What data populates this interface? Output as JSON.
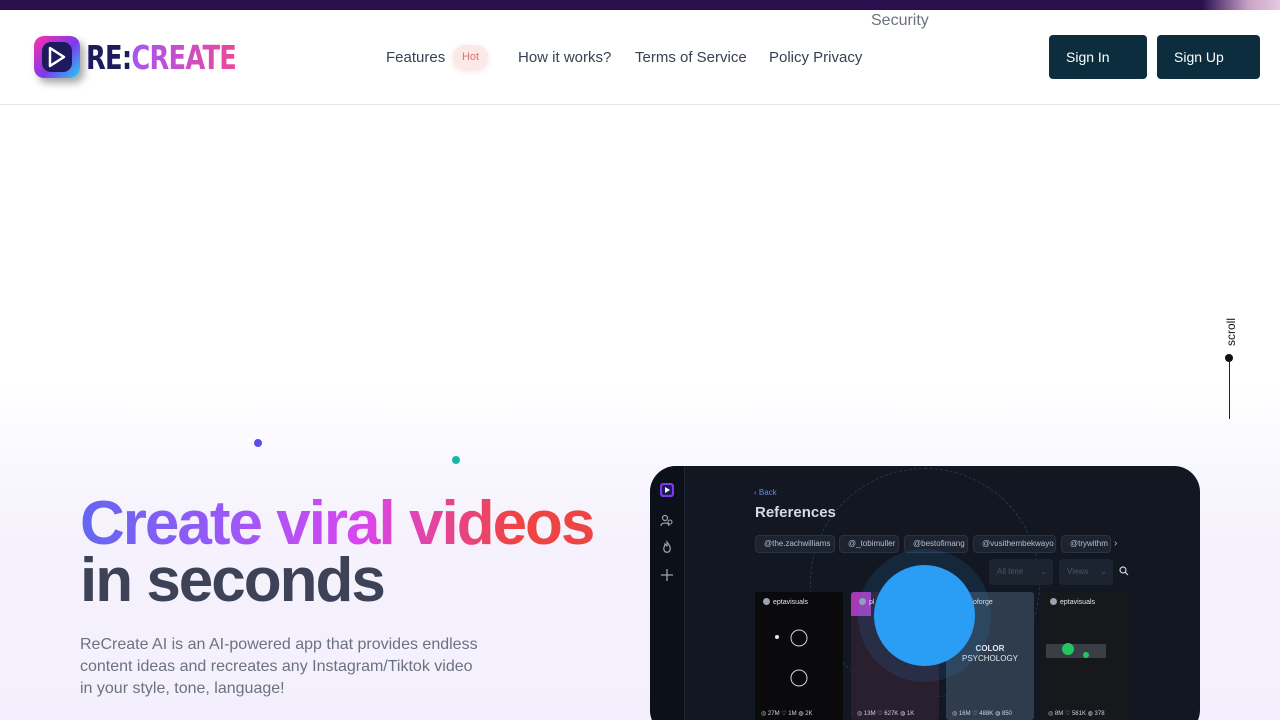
{
  "topbar": {
    "security_label": "Security"
  },
  "logo": {
    "prefix": "RE:",
    "suffix": "CREATE"
  },
  "nav": {
    "features": "Features",
    "hot_badge": "Hot",
    "how_it_works": "How it works?",
    "terms": "Terms of Service",
    "privacy": "Policy Privacy"
  },
  "auth": {
    "sign_in": "Sign In",
    "sign_up": "Sign Up"
  },
  "scroll": {
    "label": "scroll"
  },
  "hero": {
    "headline_gradient": "Create viral videos",
    "headline_plain": "in seconds",
    "description": "ReCreate AI is an AI-powered app that provides endless content ideas and recreates any Instagram/Tiktok video in your style, tone, language!"
  },
  "app_preview": {
    "back": "‹ Back",
    "title": "References",
    "chips": [
      "@the.zachwilliams",
      "@_tobimuller",
      "@bestofimang",
      "@vusithembekwayo",
      "@trywithm"
    ],
    "filters": [
      "All time",
      "Views"
    ],
    "cards": [
      {
        "user": "eptavisuals",
        "stats": "◎ 27M  ♡ 1M  ◍ 2K"
      },
      {
        "user": "pl",
        "stats": "◎ 13M  ♡ 627K  ◍ 1K"
      },
      {
        "user": "coloforge",
        "title": "COLOR",
        "subtitle": "PSYCHOLOGY",
        "stats": "◎ 16M  ♡ 488K  ◍ 850"
      },
      {
        "user": "eptavisuals",
        "stats": "◎ 8M  ♡ 581K  ◍ 378"
      }
    ]
  },
  "colors": {
    "brand_dark": "#0c2d3e",
    "accent_blue": "#2a9df4",
    "gradient_start": "#6366f1",
    "gradient_end": "#ef4444"
  }
}
